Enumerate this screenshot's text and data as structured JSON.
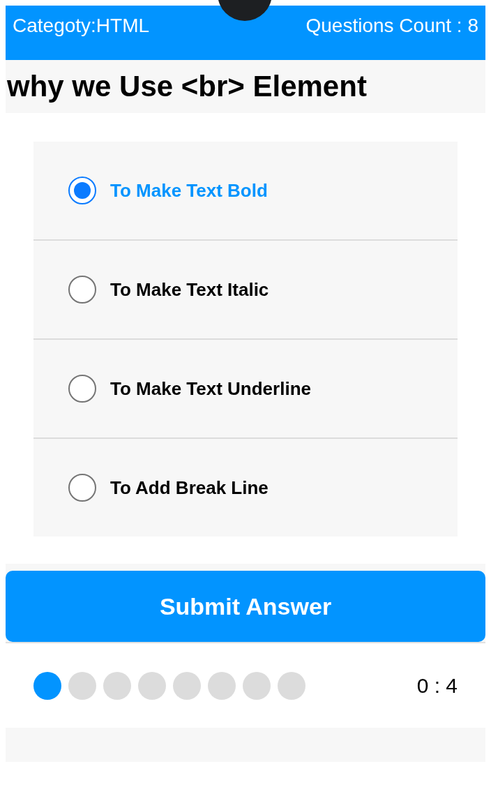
{
  "header": {
    "category": "Categoty:HTML",
    "questions_count": "Questions Count : 8"
  },
  "question": {
    "title": "why we Use <br> Element"
  },
  "options": [
    {
      "label": "To Make Text Bold",
      "selected": true
    },
    {
      "label": "To Make Text Italic",
      "selected": false
    },
    {
      "label": "To Make Text Underline",
      "selected": false
    },
    {
      "label": "To Add Break Line",
      "selected": false
    }
  ],
  "submit_button": {
    "label": "Submit Answer"
  },
  "progress": {
    "steps": [
      {
        "active": true
      },
      {
        "active": false
      },
      {
        "active": false
      },
      {
        "active": false
      },
      {
        "active": false
      },
      {
        "active": false
      },
      {
        "active": false
      },
      {
        "active": false
      }
    ],
    "score": "0 : 4"
  }
}
